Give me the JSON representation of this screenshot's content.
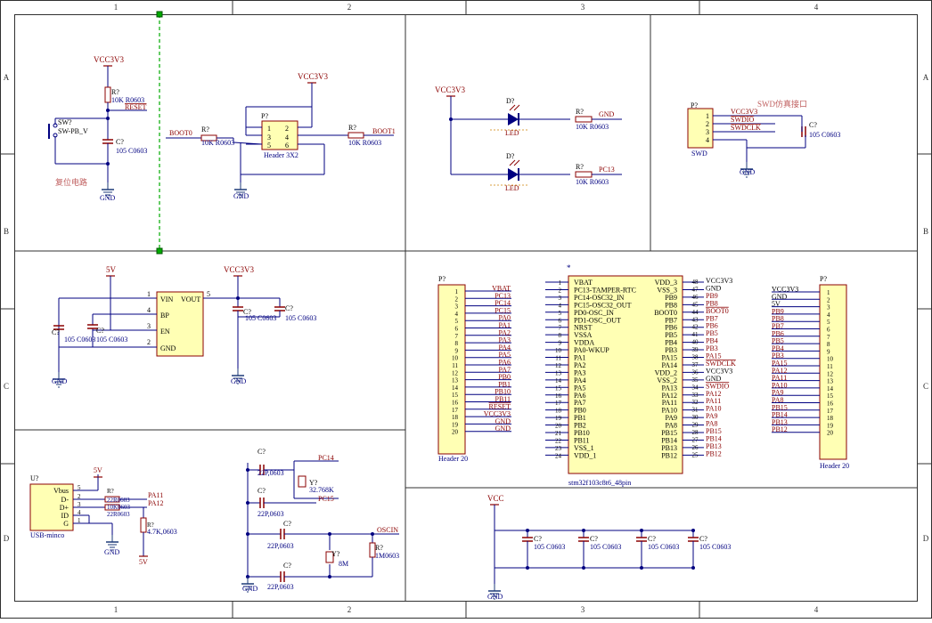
{
  "colors": {
    "border": "#303030",
    "wire": "#000080",
    "component": "#8b0000",
    "component_fill": "#ffffb4",
    "designator": "#000000",
    "label_wire": "#8b0000",
    "gnd": "#1e3a78",
    "note": "#c06060",
    "junction": "#000080",
    "guide": "#00aa00"
  },
  "frame": {
    "col_labels": [
      "1",
      "2",
      "3",
      "4"
    ],
    "row_labels": [
      "A",
      "B",
      "C",
      "D"
    ]
  },
  "reset": {
    "vcc": "VCC3V3",
    "r_des": "R?",
    "r_val": "10K R0603",
    "net": "RESET",
    "sw_des": "SW?",
    "sw_val": "SW-PB_V",
    "c_des": "C?",
    "c_val": "105 C0603",
    "gnd": "GND",
    "note": "复位电路"
  },
  "boot": {
    "vcc": "VCC3V3",
    "hdr_des": "P?",
    "hdr_val": "Header 3X2",
    "pins": [
      "1",
      "2",
      "3",
      "4",
      "5",
      "6"
    ],
    "left_net": "BOOT0",
    "right_net": "BOOT1",
    "r_des": "R?",
    "r_val": "10K R0603",
    "gnd": "GND"
  },
  "led": {
    "vcc": "VCC3V3",
    "d_des": "D?",
    "d_val": "LED",
    "r_des": "R?",
    "r_val": "10K R0603",
    "net1": "GND",
    "net2": "PC13"
  },
  "swd": {
    "title": "SWD仿真接口",
    "hdr_des": "P?",
    "hdr_val": "SWD",
    "pins": [
      "1",
      "2",
      "3",
      "4"
    ],
    "nets": [
      "VCC3V3",
      "SWDIO",
      "SWDCLK"
    ],
    "c_des": "C?",
    "c_val": "105 C0603",
    "gnd": "GND"
  },
  "ldo": {
    "vin_net": "5V",
    "vout_net": "VCC3V3",
    "pin_nums": [
      "1",
      "4",
      "3",
      "2",
      "5"
    ],
    "pins": [
      "VIN",
      "VOUT",
      "BP",
      "EN",
      "GND"
    ],
    "c_des": "C?",
    "c_val": "105 C0603",
    "gnd": "GND"
  },
  "usb": {
    "des": "U?",
    "val": "USB-minco",
    "pin_names": [
      "Vbus",
      "D-",
      "D+",
      "ID",
      "G"
    ],
    "pin_nums": [
      "5",
      "2",
      "3",
      "4",
      "1"
    ],
    "vbus_net": "5V",
    "r_des": "R?",
    "r_val1": "22R0603",
    "r_val2": "10K0603",
    "r_val3": "22R0603",
    "r_val4": "4.7K,0603",
    "net1": "PA11",
    "net2": "PA12",
    "pull_net": "5V",
    "gnd": "GND"
  },
  "xtal32": {
    "c_des": "C?",
    "c_val": "22P,0603",
    "y_des": "Y?",
    "y_val": "32.768K",
    "net1": "PC14",
    "net2": "PC15",
    "gnd": "GND"
  },
  "xtal8": {
    "c_des": "C?",
    "c_val": "22P,0603",
    "y_des": "Y?",
    "y_val": "8M",
    "r_des": "R?",
    "r_val": "1M0603",
    "net": "OSCIN"
  },
  "hdr_left": {
    "des": "P?",
    "val": "Header 20",
    "pins": [
      "1",
      "2",
      "3",
      "4",
      "5",
      "6",
      "7",
      "8",
      "9",
      "10",
      "11",
      "12",
      "13",
      "14",
      "15",
      "16",
      "17",
      "18",
      "19",
      "20"
    ],
    "nets": [
      "VBAT",
      "PC13",
      "PC14",
      "PC15",
      "PA0",
      "PA1",
      "PA2",
      "PA3",
      "PA4",
      "PA5",
      "PA6",
      "PA7",
      "PB0",
      "PB1",
      "PB10",
      "PB11",
      "RESET",
      "VCC3V3",
      "GND",
      "GND"
    ]
  },
  "mcu": {
    "star": "*",
    "part": "stm32f103c8t6_48pin",
    "left_nums": [
      "1",
      "2",
      "3",
      "4",
      "5",
      "6",
      "7",
      "8",
      "9",
      "10",
      "11",
      "12",
      "13",
      "14",
      "15",
      "16",
      "17",
      "18",
      "19",
      "20",
      "21",
      "22",
      "23",
      "24"
    ],
    "left_names": [
      "VBAT",
      "PC13-TAMPER-RTC",
      "PC14-OSC32_IN",
      "PC15-OSC32_OUT",
      "PD0-OSC_IN",
      "PD1-OSC_OUT",
      "NRST",
      "VSSA",
      "VDDA",
      "PA0-WKUP",
      "PA1",
      "PA2",
      "PA3",
      "PA4",
      "PA5",
      "PA6",
      "PA7",
      "PB0",
      "PB1",
      "PB2",
      "PB10",
      "PB11",
      "VSS_1",
      "VDD_1"
    ],
    "right_nums": [
      "48",
      "47",
      "46",
      "45",
      "44",
      "43",
      "42",
      "41",
      "40",
      "39",
      "38",
      "37",
      "36",
      "35",
      "34",
      "33",
      "32",
      "31",
      "30",
      "29",
      "28",
      "27",
      "26",
      "25"
    ],
    "right_names": [
      "VDD_3",
      "VSS_3",
      "PB9",
      "PB8",
      "BOOT0",
      "PB7",
      "PB6",
      "PB5",
      "PB4",
      "PB3",
      "PA15",
      "PA14",
      "VDD_2",
      "VSS_2",
      "PA13",
      "PA12",
      "PA11",
      "PA10",
      "PA9",
      "PA8",
      "PB15",
      "PB14",
      "PB13",
      "PB12"
    ],
    "right_nets": [
      "VCC3V3",
      "GND",
      "PB9",
      "PB8",
      "BOOT0",
      "PB7",
      "PB6",
      "PB5",
      "PB4",
      "PB3",
      "PA15",
      "SWDCLK",
      "VCC3V3",
      "GND",
      "SWDIO",
      "PA12",
      "PA11",
      "PA10",
      "PA9",
      "PA8",
      "PB15",
      "PB14",
      "PB13",
      "PB12"
    ]
  },
  "hdr_right": {
    "des": "P?",
    "val": "Header 20",
    "pins": [
      "1",
      "2",
      "3",
      "4",
      "5",
      "6",
      "7",
      "8",
      "9",
      "10",
      "11",
      "12",
      "13",
      "14",
      "15",
      "16",
      "17",
      "18",
      "19",
      "20"
    ],
    "nets": [
      "VCC3V3",
      "GND",
      "5V",
      "PB9",
      "PB8",
      "PB7",
      "PB6",
      "PB5",
      "PB4",
      "PB3",
      "PA15",
      "PA12",
      "PA11",
      "PA10",
      "PA9",
      "PA8",
      "PB15",
      "PB14",
      "PB13",
      "PB12"
    ]
  },
  "decoup": {
    "net": "VCC",
    "c_des": "C?",
    "c_val": "105 C0603",
    "gnd": "GND"
  }
}
